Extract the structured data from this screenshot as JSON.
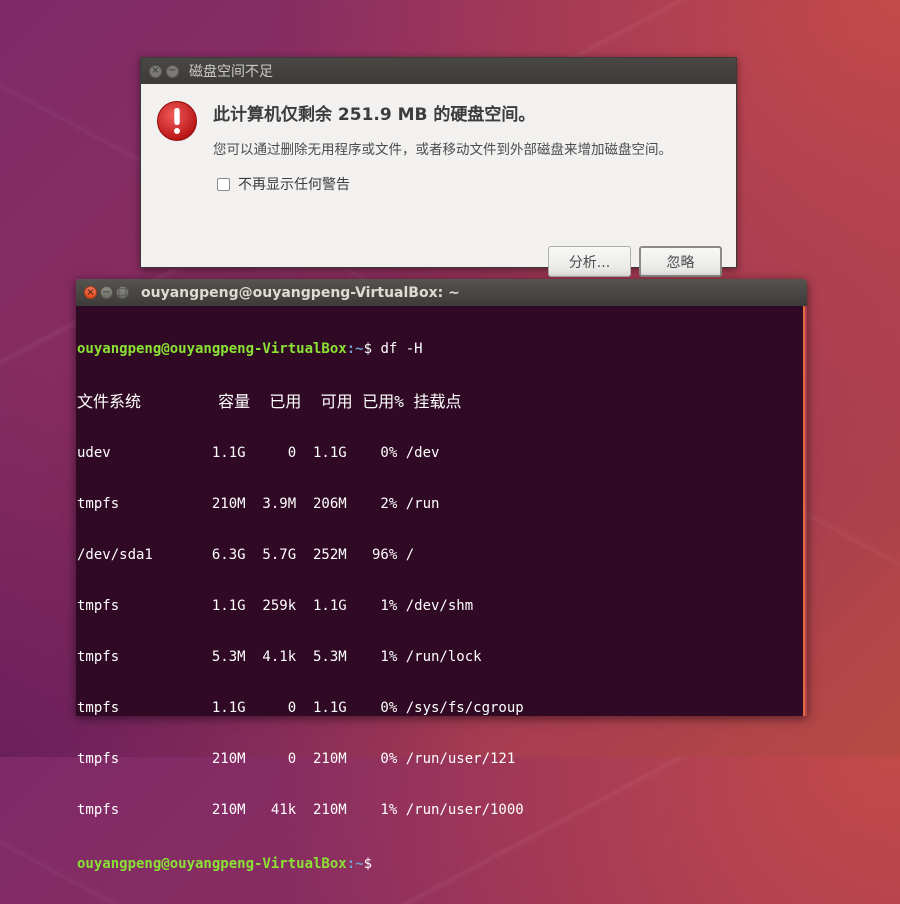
{
  "dialog": {
    "title": "磁盘空间不足",
    "heading": "此计算机仅剩余 251.9 MB 的硬盘空间。",
    "message": "您可以通过删除无用程序或文件，或者移动文件到外部磁盘来增加磁盘空间。",
    "checkbox_label": "不再显示任何警告",
    "analyze_button": "分析...",
    "ignore_button": "忽略",
    "close_glyph": "×",
    "minimize_glyph": "−"
  },
  "terminal": {
    "title": "ouyangpeng@ouyangpeng-VirtualBox: ~",
    "close_glyph": "×",
    "minimize_glyph": "−",
    "maximize_glyph": "□",
    "prompt_user": "ouyangpeng@ouyangpeng-VirtualBox",
    "prompt_path": ":~",
    "prompt_symbol": "$",
    "command": " df -H",
    "header": "文件系统        容量  已用  可用 已用% 挂载点",
    "rows": [
      "udev            1.1G     0  1.1G    0% /dev",
      "tmpfs           210M  3.9M  206M    2% /run",
      "/dev/sda1       6.3G  5.7G  252M   96% /",
      "tmpfs           1.1G  259k  1.1G    1% /dev/shm",
      "tmpfs           5.3M  4.1k  5.3M    1% /run/lock",
      "tmpfs           1.1G     0  1.1G    0% /sys/fs/cgroup",
      "tmpfs           210M     0  210M    0% /run/user/121",
      "tmpfs           210M   41k  210M    1% /run/user/1000"
    ]
  },
  "colors": {
    "prompt_user": "#8ae234",
    "prompt_path": "#729fcf",
    "terminal_bg": "#300a24",
    "alert_red": "#d81e1e"
  }
}
